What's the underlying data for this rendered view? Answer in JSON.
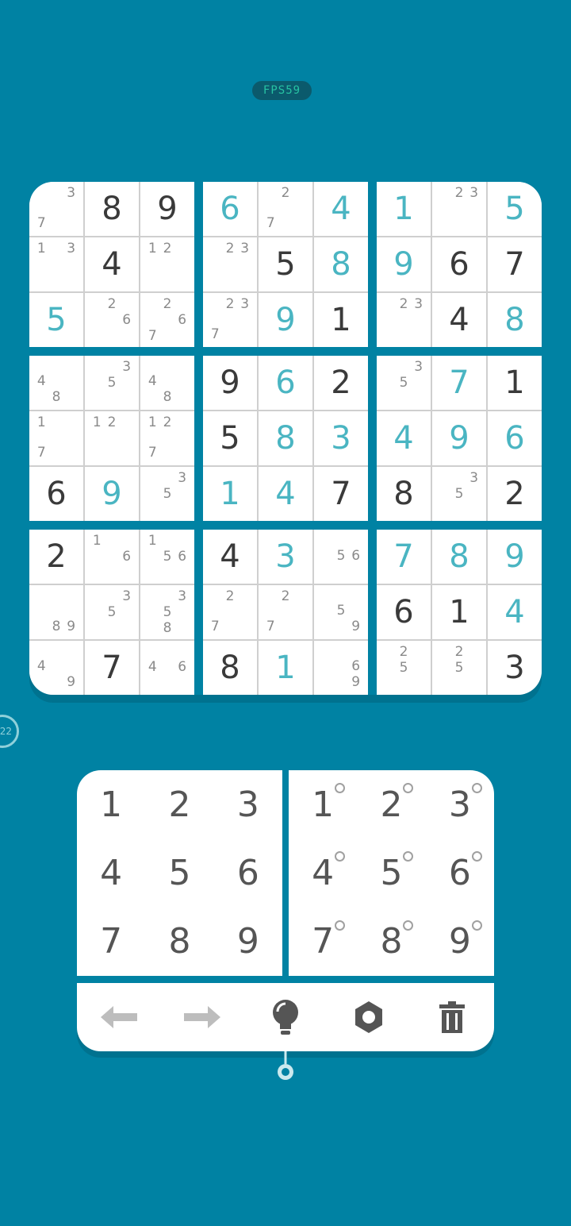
{
  "fps_label": "FPS59",
  "timer_label": "22",
  "colors": {
    "background": "#0082a3",
    "given": "#3a3a3a",
    "user": "#4ab5c2",
    "note": "#8a8a8a"
  },
  "board": {
    "rows": [
      [
        {
          "v": "",
          "n": [
            3,
            7
          ]
        },
        {
          "v": "8",
          "t": "g"
        },
        {
          "v": "9",
          "t": "g"
        },
        {
          "v": "6",
          "t": "u"
        },
        {
          "v": "",
          "n": [
            2,
            7
          ]
        },
        {
          "v": "4",
          "t": "u"
        },
        {
          "v": "1",
          "t": "u"
        },
        {
          "v": "",
          "n": [
            2,
            3
          ]
        },
        {
          "v": "5",
          "t": "u"
        }
      ],
      [
        {
          "v": "",
          "n": [
            1,
            3
          ]
        },
        {
          "v": "4",
          "t": "g"
        },
        {
          "v": "",
          "n": [
            1,
            2
          ]
        },
        {
          "v": "",
          "n": [
            2,
            3
          ]
        },
        {
          "v": "5",
          "t": "g"
        },
        {
          "v": "8",
          "t": "u"
        },
        {
          "v": "9",
          "t": "u"
        },
        {
          "v": "6",
          "t": "g"
        },
        {
          "v": "7",
          "t": "g"
        }
      ],
      [
        {
          "v": "5",
          "t": "u"
        },
        {
          "v": "",
          "n": [
            2,
            6
          ]
        },
        {
          "v": "",
          "n": [
            2,
            6,
            7
          ]
        },
        {
          "v": "",
          "n": [
            2,
            3,
            7
          ]
        },
        {
          "v": "9",
          "t": "u"
        },
        {
          "v": "1",
          "t": "g"
        },
        {
          "v": "",
          "n": [
            2,
            3
          ]
        },
        {
          "v": "4",
          "t": "g"
        },
        {
          "v": "8",
          "t": "u"
        }
      ],
      [
        {
          "v": "",
          "n": [
            4,
            8
          ]
        },
        {
          "v": "",
          "n": [
            3,
            5
          ]
        },
        {
          "v": "",
          "n": [
            4,
            8
          ]
        },
        {
          "v": "9",
          "t": "g"
        },
        {
          "v": "6",
          "t": "u"
        },
        {
          "v": "2",
          "t": "g"
        },
        {
          "v": "",
          "n": [
            3,
            5
          ]
        },
        {
          "v": "7",
          "t": "u"
        },
        {
          "v": "1",
          "t": "g"
        }
      ],
      [
        {
          "v": "",
          "n": [
            1,
            7
          ]
        },
        {
          "v": "",
          "n": [
            1,
            2
          ]
        },
        {
          "v": "",
          "n": [
            1,
            2,
            7
          ]
        },
        {
          "v": "5",
          "t": "g"
        },
        {
          "v": "8",
          "t": "u"
        },
        {
          "v": "3",
          "t": "u"
        },
        {
          "v": "4",
          "t": "u"
        },
        {
          "v": "9",
          "t": "u"
        },
        {
          "v": "6",
          "t": "u"
        }
      ],
      [
        {
          "v": "6",
          "t": "g"
        },
        {
          "v": "9",
          "t": "u"
        },
        {
          "v": "",
          "n": [
            3,
            5
          ]
        },
        {
          "v": "1",
          "t": "u"
        },
        {
          "v": "4",
          "t": "u"
        },
        {
          "v": "7",
          "t": "g"
        },
        {
          "v": "8",
          "t": "g"
        },
        {
          "v": "",
          "n": [
            3,
            5
          ]
        },
        {
          "v": "2",
          "t": "g"
        }
      ],
      [
        {
          "v": "2",
          "t": "g"
        },
        {
          "v": "",
          "n": [
            1,
            6
          ]
        },
        {
          "v": "",
          "n": [
            1,
            5,
            6
          ]
        },
        {
          "v": "4",
          "t": "g"
        },
        {
          "v": "3",
          "t": "u"
        },
        {
          "v": "",
          "n": [
            5,
            6
          ]
        },
        {
          "v": "7",
          "t": "u"
        },
        {
          "v": "8",
          "t": "u"
        },
        {
          "v": "9",
          "t": "u"
        }
      ],
      [
        {
          "v": "",
          "n": [
            8,
            9
          ]
        },
        {
          "v": "",
          "n": [
            3,
            5
          ]
        },
        {
          "v": "",
          "n": [
            3,
            5,
            8
          ]
        },
        {
          "v": "",
          "n": [
            2,
            7
          ]
        },
        {
          "v": "",
          "n": [
            2,
            7
          ]
        },
        {
          "v": "",
          "n": [
            5,
            9
          ]
        },
        {
          "v": "6",
          "t": "g"
        },
        {
          "v": "1",
          "t": "g"
        },
        {
          "v": "4",
          "t": "u"
        }
      ],
      [
        {
          "v": "",
          "n": [
            4,
            9
          ]
        },
        {
          "v": "7",
          "t": "g"
        },
        {
          "v": "",
          "n": [
            4,
            6
          ]
        },
        {
          "v": "8",
          "t": "g"
        },
        {
          "v": "1",
          "t": "u"
        },
        {
          "v": "",
          "n": [
            6,
            9
          ]
        },
        {
          "v": "",
          "n": [
            2,
            5
          ]
        },
        {
          "v": "",
          "n": [
            2,
            5
          ]
        },
        {
          "v": "3",
          "t": "g"
        }
      ]
    ]
  },
  "number_pad": [
    "1",
    "2",
    "3",
    "4",
    "5",
    "6",
    "7",
    "8",
    "9"
  ],
  "note_pad": [
    "1",
    "2",
    "3",
    "4",
    "5",
    "6",
    "7",
    "8",
    "9"
  ],
  "toolbar": {
    "icons": [
      "undo-arrow-icon",
      "redo-arrow-icon",
      "hint-bulb-icon",
      "settings-gear-icon",
      "delete-trash-icon"
    ]
  }
}
